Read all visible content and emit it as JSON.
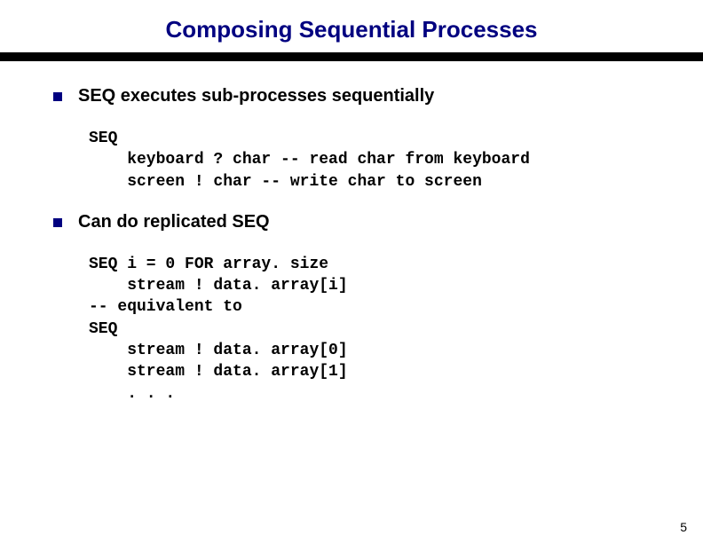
{
  "title": "Composing Sequential Processes",
  "bullets": {
    "one": "SEQ executes sub-processes sequentially",
    "two": "Can do replicated SEQ"
  },
  "code": {
    "block1": "SEQ\n    keyboard ? char -- read char from keyboard\n    screen ! char -- write char to screen",
    "block2": "SEQ i = 0 FOR array. size\n    stream ! data. array[i]\n-- equivalent to\nSEQ\n    stream ! data. array[0]\n    stream ! data. array[1]\n    . . ."
  },
  "page_number": "5"
}
